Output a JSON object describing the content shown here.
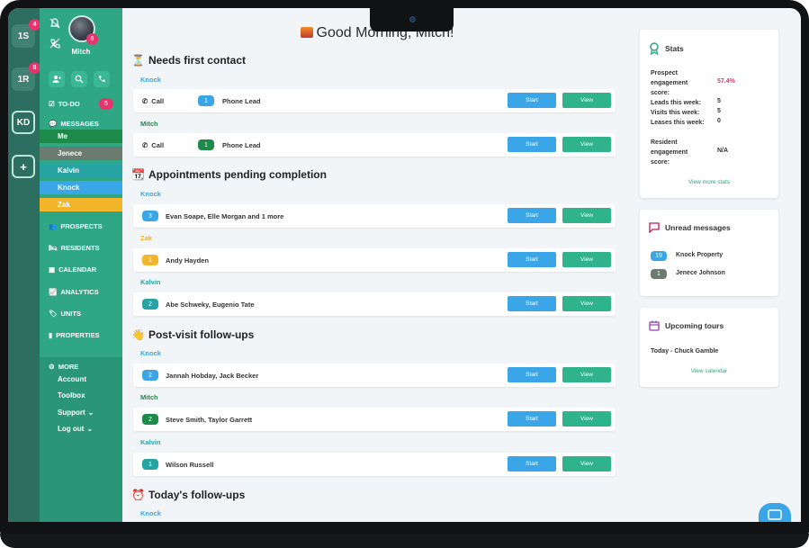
{
  "rail": {
    "items": [
      {
        "label": "1S",
        "badge": "4"
      },
      {
        "label": "1R",
        "badge": "8"
      },
      {
        "label": "KD",
        "badge": ""
      },
      {
        "label": "+",
        "badge": ""
      }
    ]
  },
  "sidebar": {
    "user_name": "Mitch",
    "avatar_badge": "8",
    "todo_label": "TO-DO",
    "todo_badge": "5",
    "messages_label": "MESSAGES",
    "message_items": [
      {
        "label": "Me",
        "color": "#1d8a4a"
      },
      {
        "label": "Jenece",
        "color": "#6b7b6f"
      },
      {
        "label": "Kalvin",
        "color": "#27a3a3"
      },
      {
        "label": "Knock",
        "color": "#3aa6e8"
      },
      {
        "label": "Zak",
        "color": "#f3b52a"
      }
    ],
    "nav": [
      {
        "label": "PROSPECTS",
        "icon": "users-icon"
      },
      {
        "label": "RESIDENTS",
        "icon": "bed-icon"
      },
      {
        "label": "CALENDAR",
        "icon": "calendar-icon"
      },
      {
        "label": "ANALYTICS",
        "icon": "chart-icon"
      },
      {
        "label": "UNITS",
        "icon": "tag-icon"
      },
      {
        "label": "PROPERTIES",
        "icon": "building-icon"
      }
    ],
    "more_label": "MORE",
    "more_items": [
      "Account",
      "Toolbox",
      "Support",
      "Log out"
    ]
  },
  "main": {
    "greeting": "Good Morning, Mitch!",
    "sections": {
      "first_contact": {
        "title": "Needs first contact",
        "groups": [
          {
            "label": "Knock",
            "color": "#3aa6e8",
            "call": "Call",
            "badge": "1",
            "badge_color": "#3aa6e8",
            "text": "Phone Lead"
          },
          {
            "label": "Mitch",
            "color": "#1d8a4a",
            "call": "Call",
            "badge": "1",
            "badge_color": "#1d8a4a",
            "text": "Phone Lead"
          }
        ]
      },
      "appointments": {
        "title": "Appointments pending completion",
        "groups": [
          {
            "label": "Knock",
            "color": "#3aa6e8",
            "badge": "3",
            "badge_color": "#3aa6e8",
            "text": "Evan Soape, Elle Morgan and 1 more"
          },
          {
            "label": "Zak",
            "color": "#f3b52a",
            "badge": "1",
            "badge_color": "#f3b52a",
            "text": "Andy Hayden"
          },
          {
            "label": "Kalvin",
            "color": "#27a3a3",
            "badge": "2",
            "badge_color": "#27a3a3",
            "text": "Abe Schweky, Eugenio Tate"
          }
        ]
      },
      "post_visit": {
        "title": "Post-visit follow-ups",
        "groups": [
          {
            "label": "Knock",
            "color": "#3aa6e8",
            "badge": "2",
            "badge_color": "#3aa6e8",
            "text": "Jannah Hobday, Jack Becker"
          },
          {
            "label": "Mitch",
            "color": "#1d8a4a",
            "badge": "2",
            "badge_color": "#1d8a4a",
            "text": "Steve Smith, Taylor Garrett"
          },
          {
            "label": "Kalvin",
            "color": "#27a3a3",
            "badge": "1",
            "badge_color": "#27a3a3",
            "text": "Wilson Russell"
          }
        ]
      },
      "todays": {
        "title": "Today's follow-ups",
        "groups": [
          {
            "label": "Knock",
            "color": "#3aa6e8"
          }
        ]
      }
    },
    "start_label": "Start",
    "view_label": "View"
  },
  "stats": {
    "title": "Stats",
    "rows": [
      {
        "label": "Prospect engagement score:",
        "value": "57.4%",
        "value_color": "#e8336c"
      },
      {
        "label": "Leads this week:",
        "value": "5"
      },
      {
        "label": "Visits this week:",
        "value": "5"
      },
      {
        "label": "Leases this week:",
        "value": "0"
      },
      {
        "label": "Resident engagement score:",
        "value": "N/A"
      }
    ],
    "link": "View more stats"
  },
  "unread": {
    "title": "Unread messages",
    "items": [
      {
        "badge": "19",
        "color": "#3aa6e8",
        "label": "Knock Property"
      },
      {
        "badge": "1",
        "color": "#6b7b6f",
        "label": "Jenece Johnson"
      }
    ]
  },
  "tours": {
    "title": "Upcoming tours",
    "item": "Today - Chuck Gamble",
    "link": "View calendar"
  },
  "colors": {
    "sidebar": "#2fa684",
    "rail": "#2c6e5f",
    "start": "#3aa6e8",
    "view": "#2fb38a",
    "badge": "#e8336c"
  }
}
